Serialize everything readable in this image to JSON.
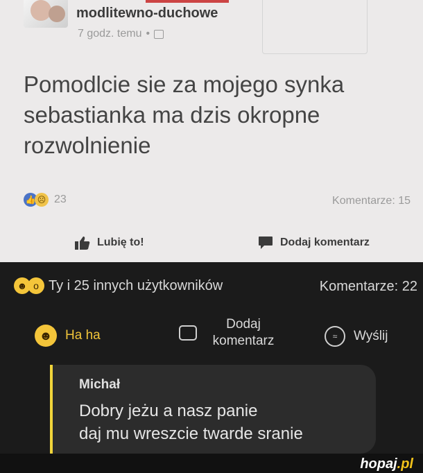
{
  "post": {
    "username": "modlitewno-duchowe",
    "time": "7 godz. temu",
    "text": "Pomodlcie sie za mojego synka sebastianka ma dzis okropne rozwolnienie",
    "reaction_count": "23",
    "comments": "Komentarze: 15",
    "like_label": "Lubię to!",
    "comment_label": "Dodaj komentarz"
  },
  "dark": {
    "reactions_label": "Ty i 25 innych użytkowników",
    "comments": "Komentarze: 22",
    "haha_label": "Ha ha",
    "add_comment_line1": "Dodaj",
    "add_comment_line2": "komentarz",
    "send_label": "Wyślij",
    "comment": {
      "author": "Michał",
      "line1": "Dobry jeżu a nasz panie",
      "line2": "daj mu wreszcie twarde sranie"
    }
  },
  "watermark": {
    "brand": "hopaj",
    "tld": ".pl"
  },
  "colors": {
    "light_bg": "#eceaea",
    "dark_bg": "#1b1b1b",
    "accent_yellow": "#f0c43a",
    "like_blue": "#4a73c6"
  },
  "icons": [
    "avatar",
    "globe-icon",
    "like-reaction-icon",
    "sad-reaction-icon",
    "thumbs-up-icon",
    "comment-icon",
    "haha-emoji-icon",
    "wow-emoji-icon",
    "comment-bubble-icon",
    "messenger-icon"
  ]
}
